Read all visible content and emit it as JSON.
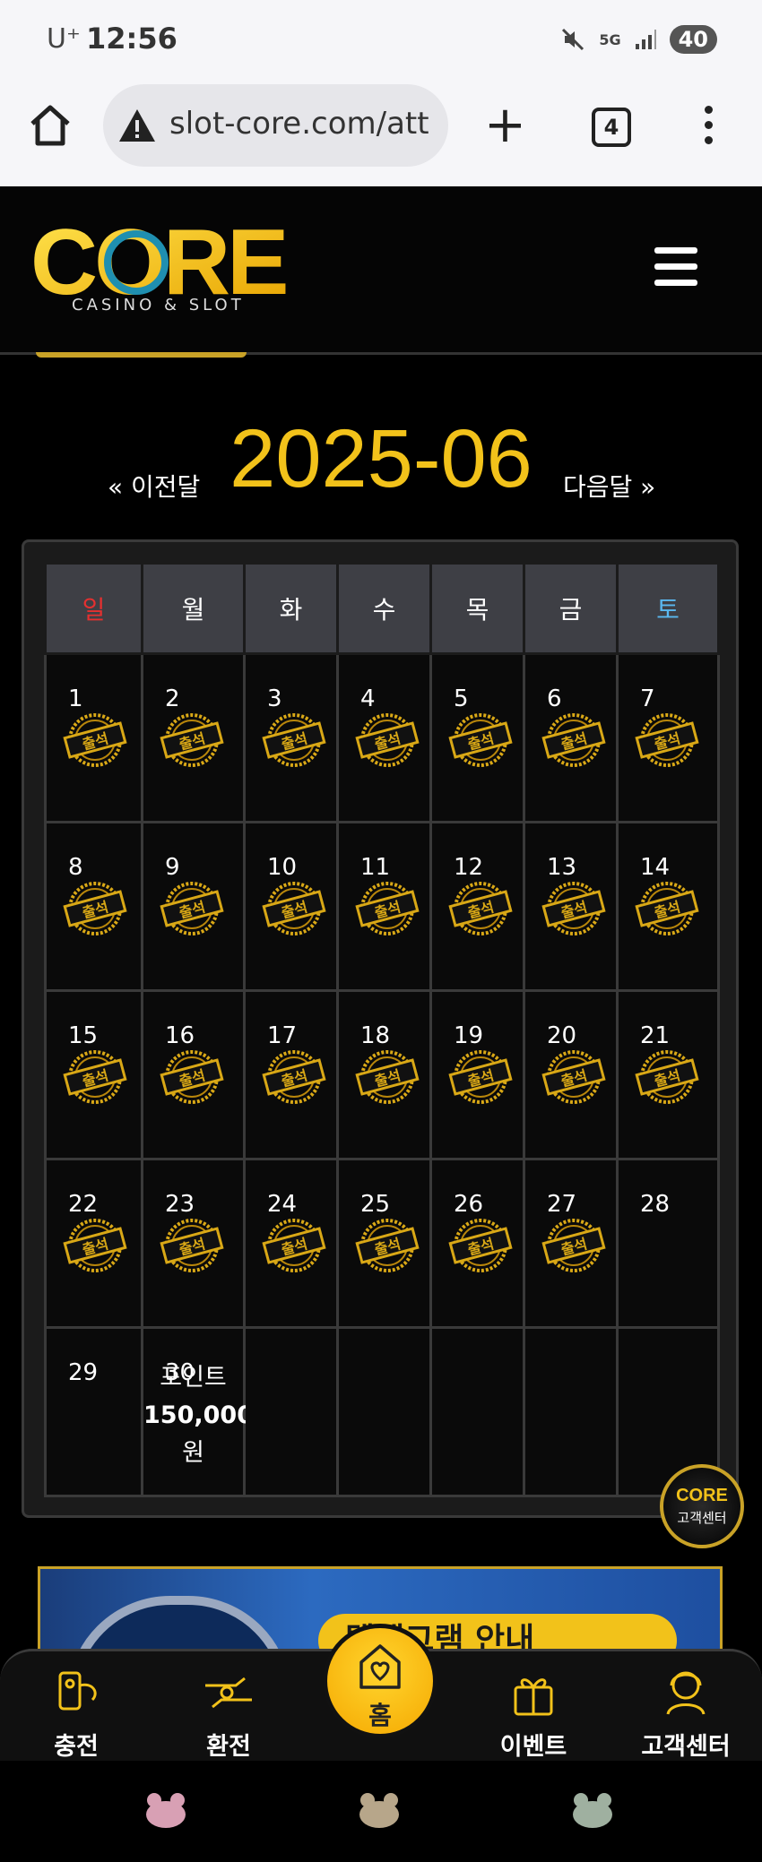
{
  "status_bar": {
    "carrier": "U⁺",
    "time": "12:56",
    "network": "5G",
    "battery": "40"
  },
  "browser": {
    "url": "slot-core.com/att",
    "tab_count": "4"
  },
  "site": {
    "logo_text": "CORE",
    "logo_subtitle": "CASINO & SLOT"
  },
  "calendar": {
    "prev_label": "« 이전달",
    "month": "2025-06",
    "next_label": "다음달 »",
    "weekdays": [
      "일",
      "월",
      "화",
      "수",
      "목",
      "금",
      "토"
    ],
    "stamp_text": "출석",
    "point_note": {
      "line1": "포인트",
      "amount": "150,000",
      "unit": "원"
    }
  },
  "support_fab": {
    "logo": "CORE",
    "label": "고객센터"
  },
  "banner": {
    "title": "텔레그램 안내"
  },
  "bottom_nav": {
    "charge": "충전",
    "exchange": "환전",
    "home": "홈",
    "event": "이벤트",
    "support": "고객센터"
  },
  "colors": {
    "gold": "#f2c21a",
    "sunday": "#e53030",
    "saturday": "#5ab8f0",
    "background": "#000000"
  }
}
